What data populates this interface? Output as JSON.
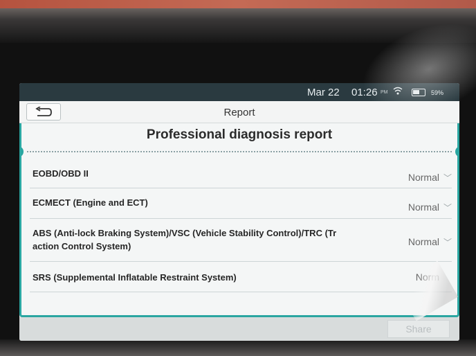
{
  "status_bar": {
    "date": "Mar 22",
    "time": "01:26",
    "ampm": "PM",
    "battery": "59%"
  },
  "title_bar": {
    "title": "Report"
  },
  "report": {
    "heading": "Professional diagnosis report",
    "rows": [
      {
        "label": "EOBD/OBD II",
        "status": "Normal"
      },
      {
        "label": "ECMECT (Engine and ECT)",
        "status": "Normal"
      },
      {
        "label_line1": "ABS (Anti-lock Braking System)/VSC (Vehicle Stability Control)/TRC (Tr",
        "label_line2": "action Control System)",
        "status": "Normal"
      },
      {
        "label": "SRS (Supplemental Inflatable Restraint System)",
        "status": "Norm"
      }
    ]
  },
  "bottom_bar": {
    "share_label": "Share"
  },
  "colors": {
    "accent": "#2aa6a1",
    "status_bar_bg": "#2a3a40"
  }
}
